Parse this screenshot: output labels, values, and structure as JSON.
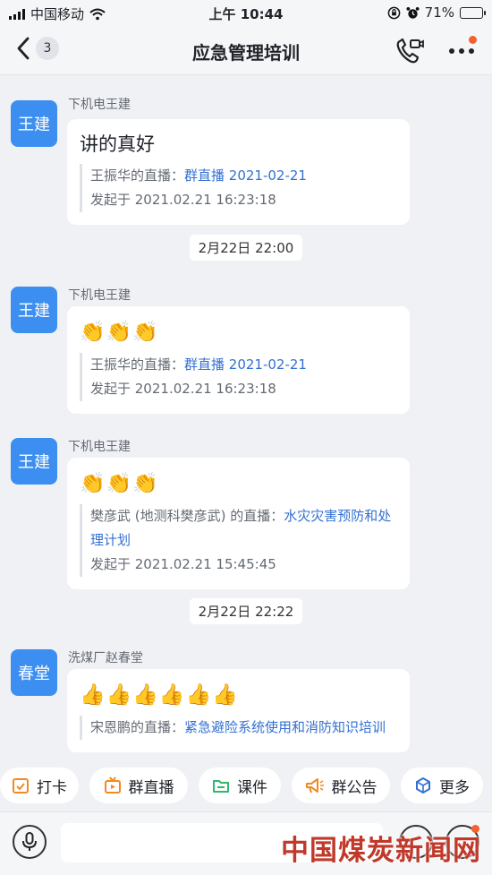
{
  "status_bar": {
    "carrier": "中国移动",
    "time": "上午 10:44",
    "battery": "71%",
    "battery_level": 0.71
  },
  "nav": {
    "title": "应急管理培训",
    "back_count": "3",
    "icons": [
      "chevron-left-icon",
      "video-call-icon",
      "more-icon"
    ]
  },
  "messages": [
    {
      "avatar": "王建",
      "sender": "下机电王建",
      "text": "讲的真好",
      "quote_prefix": "王振华的直播：",
      "quote_link": "群直播 2021-02-21",
      "started": "发起于 2021.02.21 16:23:18"
    },
    {
      "avatar": "王建",
      "sender": "下机电王建",
      "emoji": "👏👏👏",
      "quote_prefix": "王振华的直播：",
      "quote_link": "群直播 2021-02-21",
      "started": "发起于 2021.02.21 16:23:18"
    },
    {
      "avatar": "王建",
      "sender": "下机电王建",
      "emoji": "👏👏👏",
      "quote_prefix": "樊彦武 (地测科樊彦武) 的直播：",
      "quote_link": "水灾灾害预防和处理计划",
      "started": "发起于 2021.02.21 15:45:45"
    },
    {
      "avatar": "春堂",
      "sender": "洗煤厂赵春堂",
      "emoji": "👍👍👍👍👍👍",
      "quote_prefix": "宋恩鹏的直播：",
      "quote_link": "紧急避险系统使用和消防知识培训"
    }
  ],
  "timestamps": [
    "2月22日 22:00",
    "2月22日 22:22"
  ],
  "toolbar": [
    {
      "label": "打卡",
      "icon": "check-calendar-icon"
    },
    {
      "label": "群直播",
      "icon": "live-tv-icon"
    },
    {
      "label": "课件",
      "icon": "folder-icon"
    },
    {
      "label": "群公告",
      "icon": "megaphone-icon"
    },
    {
      "label": "更多",
      "icon": "cube-icon"
    }
  ],
  "input": {
    "placeholder": "",
    "icons": [
      "microphone-icon",
      "emoji-icon",
      "plus-icon"
    ]
  },
  "watermark": "中国煤炭新闻网",
  "colors": {
    "accent": "#3370d1",
    "avatar": "#3c8ef0",
    "badge": "#f5602f",
    "toolbar_icon": "#f08a24"
  }
}
